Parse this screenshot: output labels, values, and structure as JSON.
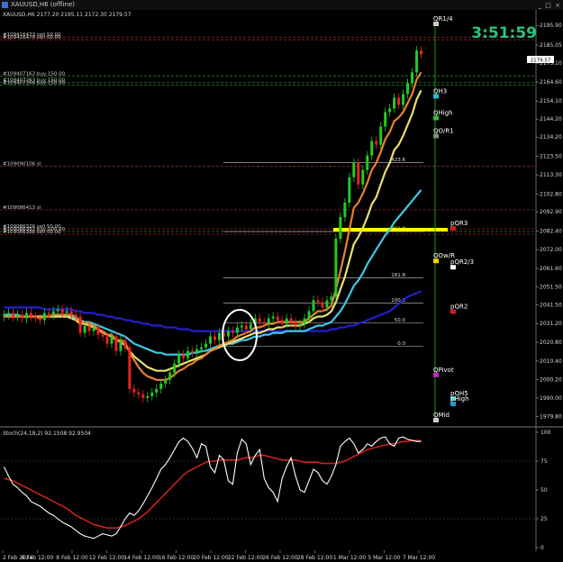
{
  "window": {
    "title": "XAUUSD,H6 (offline)",
    "controls": "_ □ ×"
  },
  "main": {
    "info_line": "XAUUSD,H6 2177.20 2195.11 2172.30 2179.57",
    "timer": "3:51:59",
    "price_tag": "2179.57",
    "colors": {
      "bull": "#22cc22",
      "bear": "#ee2222",
      "timer": "#2ec27e",
      "pivot": "#ffff00"
    }
  },
  "order_lines": [
    {
      "label": "#109416473 sell 50.00",
      "price": 2189.5
    },
    {
      "label": "#109416479 sell 50.00",
      "price": 2188.0
    },
    {
      "label": "#109407163 buy 150.00",
      "price": 2168.0
    },
    {
      "label": "#109407263 buy 150.00",
      "price": 2164.5
    },
    {
      "label": "#109407264 buy 150.00",
      "price": 2163.0
    },
    {
      "label": "#109090106 sl",
      "price": 2118.0
    },
    {
      "label": "#109086413 sl",
      "price": 2094.0
    },
    {
      "label": "#109086326 sell 50.00",
      "price": 2083.5
    },
    {
      "label": "#109086357 buy 100.00",
      "price": 2082.0
    },
    {
      "label": "#109086398 sell 50.00",
      "price": 2080.5
    }
  ],
  "fib_levels": [
    {
      "label": "423.6",
      "price": 2120.0
    },
    {
      "label": "261.8",
      "price": 2082.0
    },
    {
      "label": "161.8",
      "price": 2056.5
    },
    {
      "label": "100.0",
      "price": 2042.5
    },
    {
      "label": "50.0",
      "price": 2031.5
    },
    {
      "label": "0.0",
      "price": 2018.5
    }
  ],
  "pivot_labels": [
    {
      "label": "QR1/4",
      "price": 2197.0
    },
    {
      "label": "QH3",
      "price": 2157.0
    },
    {
      "label": "QHigh",
      "price": 2145.0
    },
    {
      "label": "QO/R1",
      "price": 2135.0
    },
    {
      "label": "pQR3",
      "price": 2084.0
    },
    {
      "label": "QOw/R",
      "price": 2066.0
    },
    {
      "label": "pQR2/3",
      "price": 2062.5
    },
    {
      "label": "pQR2",
      "price": 2038.0
    },
    {
      "label": "QPivot",
      "price": 2003.0
    },
    {
      "label": "pQH5",
      "price": 1990.0
    },
    {
      "label": "pHigh",
      "price": 1987.0
    },
    {
      "label": "QMid",
      "price": 1978.0
    }
  ],
  "stoch": {
    "label": "Stoch(24,18,2) 92.1508 92.9504"
  },
  "chart_data": [
    {
      "type": "candlestick",
      "symbol": "XAUUSD",
      "timeframe": "H6",
      "ylim": [
        1977,
        2200
      ],
      "y_ticks": [
        "2195.90",
        "2185.05",
        "2175.10",
        "2164.60",
        "2154.10",
        "2144.20",
        "2134.20",
        "2123.50",
        "2113.30",
        "2102.80",
        "2092.90",
        "2082.40",
        "2072.00",
        "2061.60",
        "2051.50",
        "2041.50",
        "2031.20",
        "2020.80",
        "2010.40",
        "2000.20",
        "1990.00",
        "1979.80"
      ],
      "x_ticks": [
        "2 Feb 2024",
        "6 Feb 12:00",
        "8 Feb 12:00",
        "12 Feb 12:00",
        "14 Feb 12:00",
        "16 Feb 12:00",
        "20 Feb 12:00",
        "22 Feb 12:00",
        "26 Feb 12:00",
        "28 Feb 12:00",
        "1 Mar 12:00",
        "5 Mar 12:00",
        "7 Mar 12:00"
      ],
      "close": [
        2036,
        2037,
        2035,
        2036,
        2034,
        2037,
        2035,
        2034,
        2033,
        2037,
        2036,
        2038,
        2039,
        2037,
        2038,
        2036,
        2035,
        2026,
        2030,
        2027,
        2029,
        2025,
        2024,
        2020,
        2024,
        2016,
        2022,
        2018,
        1995,
        1993,
        1992,
        1990,
        1991,
        1993,
        1995,
        1998,
        2000,
        2004,
        2009,
        2014,
        2012,
        2016,
        2015,
        2017,
        2018,
        2020,
        2024,
        2022,
        2026,
        2024,
        2027,
        2026,
        2029,
        2030,
        2028,
        2031,
        2034,
        2032,
        2031,
        2034,
        2035,
        2033,
        2031,
        2034,
        2032,
        2030,
        2031,
        2034,
        2038,
        2044,
        2043,
        2040,
        2044,
        2046,
        2078,
        2090,
        2098,
        2112,
        2120,
        2108,
        2116,
        2124,
        2132,
        2130,
        2140,
        2148,
        2150,
        2156,
        2152,
        2158,
        2164,
        2170,
        2182,
        2180
      ],
      "series": [
        {
          "name": "",
          "color": "#1f1fd0",
          "values": [
            2040,
            2040,
            2040,
            2040,
            2040,
            2040,
            2040,
            2040,
            2040,
            2039,
            2039,
            2039,
            2039,
            2039,
            2039,
            2039,
            2038,
            2038,
            2037,
            2037,
            2037,
            2036,
            2036,
            2035,
            2035,
            2034,
            2034,
            2033,
            2033,
            2032,
            2032,
            2031,
            2031,
            2030,
            2030,
            2030,
            2029,
            2029,
            2029,
            2028,
            2028,
            2028,
            2027,
            2027,
            2027,
            2027,
            2027,
            2027,
            2027,
            2027,
            2027,
            2027,
            2027,
            2027,
            2027,
            2027,
            2027,
            2027,
            2027,
            2027,
            2027,
            2027,
            2027,
            2027,
            2027,
            2027,
            2027,
            2027,
            2027,
            2027,
            2027,
            2027,
            2027,
            2028,
            2028,
            2029,
            2029,
            2030,
            2030,
            2031,
            2032,
            2033,
            2034,
            2035,
            2036,
            2037,
            2038,
            2040,
            2042,
            2044,
            2046,
            2047,
            2048,
            2049
          ]
        },
        {
          "name": "",
          "color": "#40c8e8",
          "values": [
            2036,
            2036,
            2036,
            2036,
            2035,
            2035,
            2035,
            2035,
            2035,
            2035,
            2035,
            2035,
            2035,
            2035,
            2035,
            2035,
            2034,
            2033,
            2032,
            2032,
            2031,
            2030,
            2029,
            2028,
            2027,
            2026,
            2025,
            2024,
            2022,
            2020,
            2019,
            2018,
            2017,
            2016,
            2015,
            2015,
            2014,
            2014,
            2014,
            2014,
            2014,
            2014,
            2015,
            2015,
            2016,
            2016,
            2017,
            2018,
            2019,
            2019,
            2020,
            2020,
            2021,
            2022,
            2022,
            2023,
            2024,
            2024,
            2025,
            2025,
            2026,
            2026,
            2026,
            2027,
            2027,
            2027,
            2027,
            2027,
            2028,
            2029,
            2030,
            2030,
            2031,
            2032,
            2035,
            2038,
            2042,
            2047,
            2052,
            2055,
            2059,
            2064,
            2068,
            2072,
            2076,
            2080,
            2083,
            2087,
            2090,
            2093,
            2096,
            2099,
            2102,
            2105
          ]
        },
        {
          "name": "",
          "color": "#e8e070",
          "values": [
            2035,
            2035,
            2035,
            2035,
            2035,
            2035,
            2035,
            2035,
            2035,
            2035,
            2035,
            2035,
            2035,
            2035,
            2035,
            2034,
            2033,
            2031,
            2031,
            2030,
            2029,
            2028,
            2026,
            2025,
            2024,
            2022,
            2021,
            2019,
            2016,
            2013,
            2011,
            2009,
            2007,
            2006,
            2005,
            2005,
            2005,
            2006,
            2007,
            2008,
            2009,
            2010,
            2011,
            2012,
            2013,
            2014,
            2016,
            2017,
            2018,
            2019,
            2020,
            2021,
            2022,
            2023,
            2024,
            2025,
            2026,
            2026,
            2027,
            2028,
            2028,
            2029,
            2029,
            2030,
            2030,
            2030,
            2030,
            2031,
            2032,
            2034,
            2035,
            2035,
            2036,
            2038,
            2043,
            2050,
            2057,
            2066,
            2075,
            2079,
            2084,
            2090,
            2097,
            2101,
            2108,
            2115,
            2120,
            2127,
            2130,
            2135,
            2141,
            2147,
            2155,
            2160
          ]
        },
        {
          "name": "",
          "color": "#e88030",
          "values": [
            2035,
            2035,
            2035,
            2035,
            2035,
            2035,
            2035,
            2035,
            2034,
            2035,
            2035,
            2036,
            2036,
            2036,
            2036,
            2036,
            2035,
            2032,
            2032,
            2031,
            2030,
            2028,
            2027,
            2025,
            2025,
            2022,
            2022,
            2021,
            2015,
            2011,
            2007,
            2004,
            2002,
            2001,
            2000,
            2000,
            2000,
            2001,
            2003,
            2005,
            2006,
            2008,
            2009,
            2011,
            2012,
            2014,
            2016,
            2017,
            2019,
            2020,
            2021,
            2022,
            2024,
            2025,
            2026,
            2027,
            2029,
            2029,
            2030,
            2031,
            2031,
            2032,
            2032,
            2032,
            2032,
            2032,
            2032,
            2032,
            2034,
            2036,
            2038,
            2038,
            2039,
            2041,
            2050,
            2060,
            2071,
            2083,
            2095,
            2098,
            2103,
            2109,
            2116,
            2120,
            2126,
            2133,
            2137,
            2143,
            2145,
            2148,
            2153,
            2158,
            2166,
            2170
          ]
        }
      ]
    },
    {
      "type": "line",
      "title": "Stoch(24,18,2) 92.1508 92.9504",
      "ylim": [
        0,
        100
      ],
      "y_ticks": [
        "100",
        "75",
        "50",
        "25",
        "0"
      ],
      "series": [
        {
          "name": "",
          "color": "#ffffff",
          "values": [
            70,
            62,
            55,
            52,
            48,
            45,
            40,
            38,
            36,
            33,
            30,
            28,
            25,
            22,
            20,
            18,
            15,
            12,
            10,
            9,
            8,
            10,
            12,
            11,
            10,
            12,
            18,
            25,
            30,
            28,
            32,
            38,
            45,
            52,
            60,
            68,
            72,
            78,
            85,
            92,
            95,
            92,
            86,
            78,
            90,
            88,
            70,
            65,
            80,
            76,
            58,
            55,
            82,
            94,
            90,
            72,
            80,
            85,
            60,
            52,
            48,
            40,
            60,
            70,
            78,
            62,
            50,
            48,
            58,
            68,
            65,
            58,
            55,
            62,
            72,
            88,
            92,
            95,
            90,
            82,
            85,
            90,
            88,
            92,
            95,
            96,
            90,
            88,
            95,
            96,
            94,
            93,
            92,
            92
          ]
        },
        {
          "name": "",
          "color": "#cc2020",
          "values": [
            60,
            59,
            58,
            56,
            54,
            52,
            50,
            48,
            46,
            44,
            42,
            40,
            38,
            36,
            34,
            31,
            28,
            26,
            24,
            22,
            20,
            19,
            18,
            17,
            17,
            17,
            18,
            19,
            21,
            23,
            25,
            28,
            31,
            35,
            39,
            43,
            47,
            51,
            55,
            59,
            63,
            66,
            68,
            70,
            72,
            74,
            75,
            75,
            76,
            76,
            76,
            76,
            76,
            77,
            78,
            78,
            79,
            80,
            80,
            79,
            78,
            77,
            76,
            76,
            76,
            76,
            75,
            74,
            74,
            74,
            74,
            73,
            73,
            73,
            73,
            74,
            75,
            77,
            79,
            81,
            83,
            85,
            86,
            87,
            88,
            89,
            90,
            90,
            91,
            92,
            92,
            93,
            93,
            93
          ]
        }
      ]
    }
  ]
}
